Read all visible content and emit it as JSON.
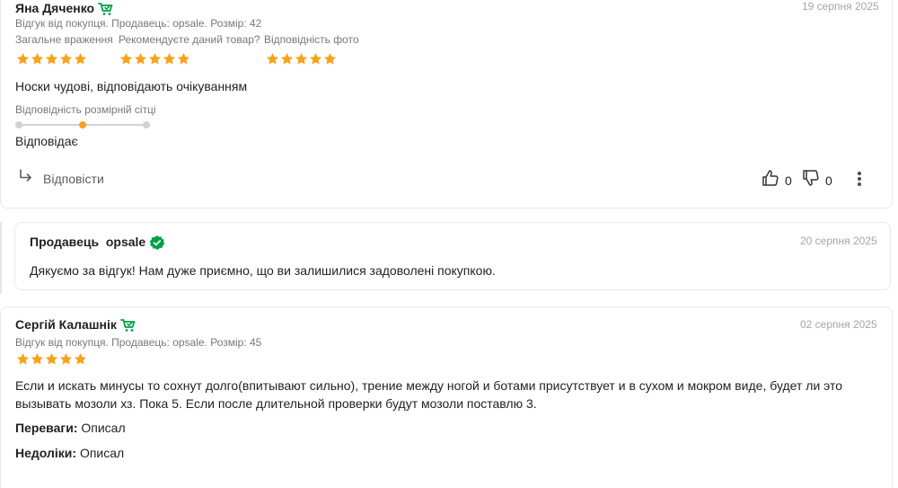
{
  "review1": {
    "author": "Яна Дяченко",
    "date": "19 серпня 2025",
    "meta": "Відгук від покупця. Продавець: opsale. Розмір: 42",
    "ratings": [
      {
        "label": "Загальне враження",
        "stars": 5
      },
      {
        "label": "Рекомендуєте даний товар?",
        "stars": 5
      },
      {
        "label": "Відповідність фото",
        "stars": 5
      }
    ],
    "text": "Носки чудові, відповідають очікуванням",
    "size_label": "Відповідність розмірній сітці",
    "size_value": "Відповідає",
    "size_level": 0.5,
    "reply_label": "Відповісти",
    "likes": "0",
    "dislikes": "0"
  },
  "seller_reply": {
    "title": "Продавець",
    "seller": "opsale",
    "date": "20 серпня 2025",
    "text": "Дякуємо за відгук! Нам дуже приємно, що ви залишилися задоволені покупкою."
  },
  "review2": {
    "author": "Сергій Калашнік",
    "date": "02 серпня 2025",
    "meta": "Відгук від покупця. Продавець: opsale. Розмір: 45",
    "stars": 5,
    "text_line1": "Если и искать минусы то сохнут долго(впитывают сильно), трение между ногой и ботами присутствует и в сухом и мокром виде, будет ли это",
    "text_line2": "вызывать мозоли хз. Пока 5. Если после длительной проверки будут мозоли поставлю 3.",
    "pros_label": "Переваги:",
    "pros": "Описал",
    "cons_label": "Недоліки:",
    "cons": "Описал"
  },
  "colors": {
    "star": "#f7a21b",
    "buyer_icon": "#00a046",
    "verified_badge": "#00a046"
  }
}
